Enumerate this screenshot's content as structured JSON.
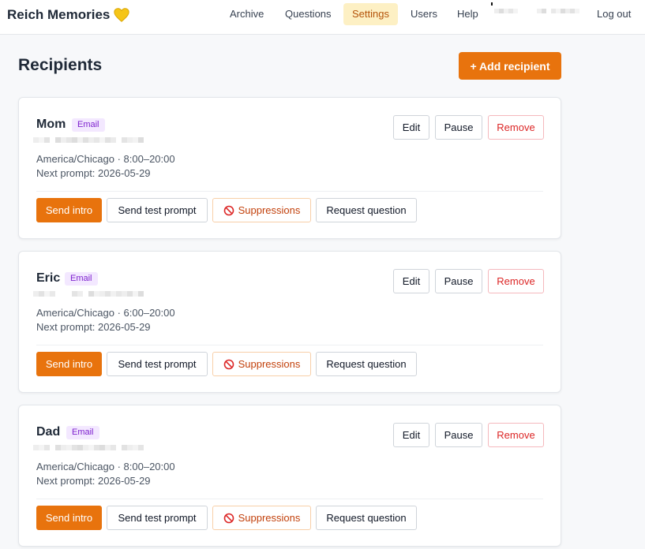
{
  "app": {
    "title": "Reich Memories",
    "logo_icon": "yellow-heart-icon"
  },
  "nav": {
    "items": [
      {
        "label": "Archive"
      },
      {
        "label": "Questions"
      },
      {
        "label": "Settings",
        "active": true
      },
      {
        "label": "Users"
      },
      {
        "label": "Help"
      }
    ],
    "logout_label": "Log out"
  },
  "page": {
    "title": "Recipients",
    "add_button_label": "+ Add recipient"
  },
  "colors": {
    "accent": "#e8730d",
    "active_nav_bg": "#fdf0c4",
    "badge_bg": "#f3e8ff",
    "badge_text": "#7e22ce",
    "danger": "#dc2626"
  },
  "recipients": [
    {
      "name": "Mom",
      "channel": "Email",
      "schedule": "America/Chicago · 8:00–20:00",
      "next_prompt": "Next prompt: 2026-05-29"
    },
    {
      "name": "Eric",
      "channel": "Email",
      "schedule": "America/Chicago · 6:00–20:00",
      "next_prompt": "Next prompt: 2026-05-29"
    },
    {
      "name": "Dad",
      "channel": "Email",
      "schedule": "America/Chicago · 8:00–20:00",
      "next_prompt": "Next prompt: 2026-05-29"
    }
  ],
  "card_actions": {
    "edit": "Edit",
    "pause": "Pause",
    "remove": "Remove",
    "send_intro": "Send intro",
    "send_test_prompt": "Send test prompt",
    "suppressions": "Suppressions",
    "suppressions_icon": "prohibited-icon",
    "request_question": "Request question"
  }
}
